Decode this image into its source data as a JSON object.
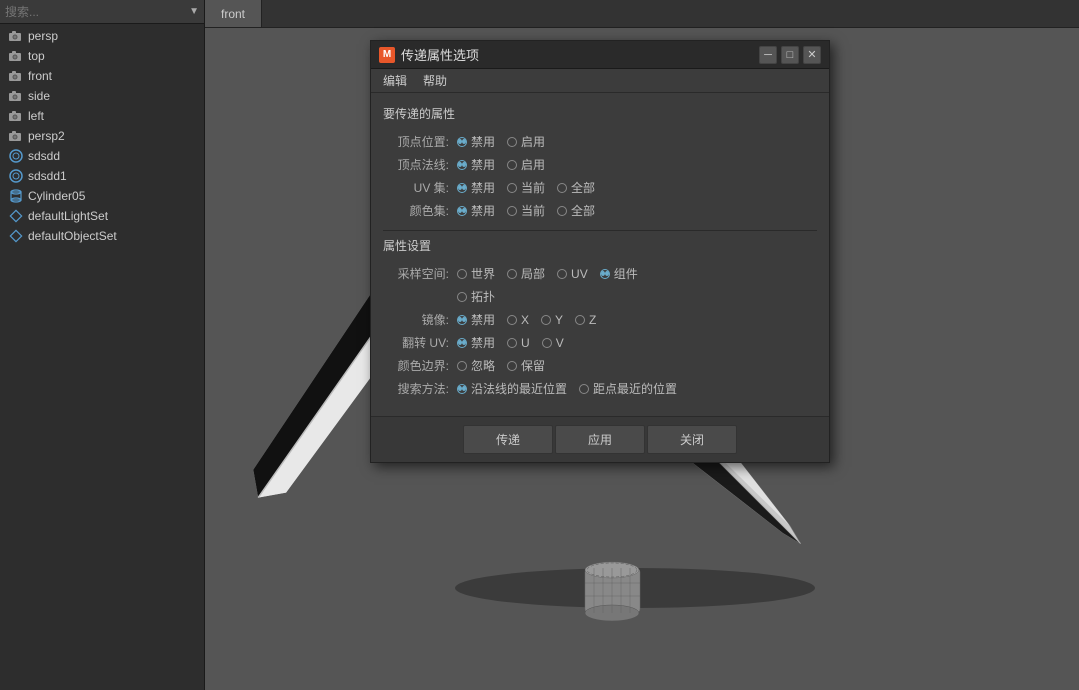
{
  "app": {
    "title": "Maya"
  },
  "sidebar": {
    "search_placeholder": "搜索...",
    "items": [
      {
        "id": "persp",
        "label": "persp",
        "icon": "camera"
      },
      {
        "id": "top",
        "label": "top",
        "icon": "camera"
      },
      {
        "id": "front",
        "label": "front",
        "icon": "camera"
      },
      {
        "id": "side",
        "label": "side",
        "icon": "camera"
      },
      {
        "id": "left",
        "label": "left",
        "icon": "camera"
      },
      {
        "id": "persp2",
        "label": "persp2",
        "icon": "camera"
      },
      {
        "id": "sdsdd",
        "label": "sdsdd",
        "icon": "sds"
      },
      {
        "id": "sdsdd1",
        "label": "sdsdd1",
        "icon": "sds"
      },
      {
        "id": "cylinder05",
        "label": "Cylinder05",
        "icon": "cylinder"
      },
      {
        "id": "defaultLightSet",
        "label": "defaultLightSet",
        "icon": "light"
      },
      {
        "id": "defaultObjectSet",
        "label": "defaultObjectSet",
        "icon": "light"
      }
    ]
  },
  "viewport": {
    "tab": "front"
  },
  "dialog": {
    "title": "传递属性选项",
    "title_icon": "M",
    "menu": {
      "items": [
        "编辑",
        "帮助"
      ]
    },
    "section1": {
      "title": "要传递的属性",
      "rows": [
        {
          "label": "顶点位置:",
          "options": [
            {
              "label": "禁用",
              "selected": true
            },
            {
              "label": "启用",
              "selected": false
            }
          ]
        },
        {
          "label": "顶点法线:",
          "options": [
            {
              "label": "禁用",
              "selected": true
            },
            {
              "label": "启用",
              "selected": false
            }
          ]
        },
        {
          "label": "UV 集:",
          "options": [
            {
              "label": "禁用",
              "selected": true
            },
            {
              "label": "当前",
              "selected": false
            },
            {
              "label": "全部",
              "selected": false
            }
          ]
        },
        {
          "label": "颜色集:",
          "options": [
            {
              "label": "禁用",
              "selected": true
            },
            {
              "label": "当前",
              "selected": false
            },
            {
              "label": "全部",
              "selected": false
            }
          ]
        }
      ]
    },
    "section2": {
      "title": "属性设置",
      "rows": [
        {
          "label": "采样空间:",
          "options": [
            {
              "label": "世界",
              "selected": false
            },
            {
              "label": "局部",
              "selected": false
            },
            {
              "label": "UV",
              "selected": false
            },
            {
              "label": "组件",
              "selected": true
            }
          ]
        },
        {
          "label": "",
          "options": [
            {
              "label": "拓扑",
              "selected": false
            }
          ]
        },
        {
          "label": "镜像:",
          "options": [
            {
              "label": "禁用",
              "selected": true
            },
            {
              "label": "X",
              "selected": false
            },
            {
              "label": "Y",
              "selected": false
            },
            {
              "label": "Z",
              "selected": false
            }
          ]
        },
        {
          "label": "翻转 UV:",
          "options": [
            {
              "label": "禁用",
              "selected": true
            },
            {
              "label": "U",
              "selected": false
            },
            {
              "label": "V",
              "selected": false
            }
          ]
        },
        {
          "label": "颜色边界:",
          "options": [
            {
              "label": "忽略",
              "selected": false
            },
            {
              "label": "保留",
              "selected": false
            }
          ]
        },
        {
          "label": "搜索方法:",
          "options": [
            {
              "label": "沿法线的最近位置",
              "selected": true
            },
            {
              "label": "距点最近的位置",
              "selected": false
            }
          ]
        }
      ]
    },
    "footer": {
      "buttons": [
        "传递",
        "应用",
        "关闭"
      ]
    }
  }
}
